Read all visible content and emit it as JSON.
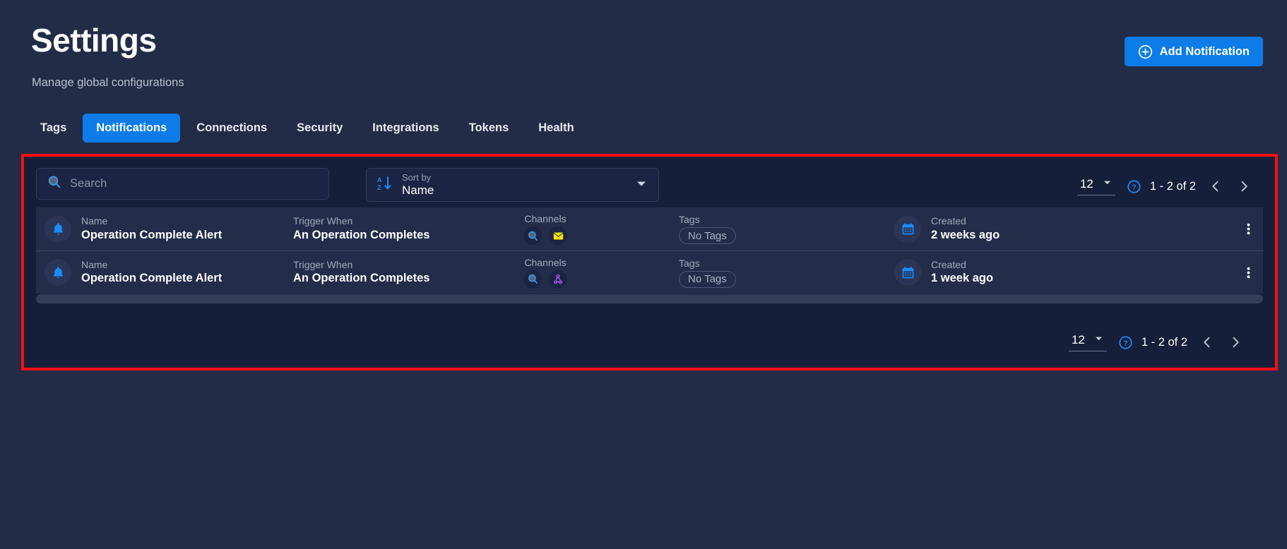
{
  "header": {
    "title": "Settings",
    "subtitle": "Manage global configurations",
    "add_button": {
      "label": "Add Notification",
      "icon": "plus-circle-icon"
    }
  },
  "tabs": [
    {
      "label": "Tags",
      "active": false
    },
    {
      "label": "Notifications",
      "active": true
    },
    {
      "label": "Connections",
      "active": false
    },
    {
      "label": "Security",
      "active": false
    },
    {
      "label": "Integrations",
      "active": false
    },
    {
      "label": "Tokens",
      "active": false
    },
    {
      "label": "Health",
      "active": false
    }
  ],
  "toolbar": {
    "search": {
      "value": "",
      "placeholder": "Search",
      "icon": "search-icon"
    },
    "sort": {
      "label": "Sort by",
      "value": "Name",
      "icon": "sort-alpha-down-icon",
      "caret": "chevron-down-icon"
    }
  },
  "pagination": {
    "page_size": "12",
    "range": "1 - 2 of 2",
    "help_icon": "question-circle-icon",
    "prev_icon": "chevron-left-icon",
    "next_icon": "chevron-right-icon",
    "caret_icon": "caret-down-icon"
  },
  "columns": {
    "name": "Name",
    "trigger": "Trigger When",
    "channels": "Channels",
    "tags": "Tags",
    "created": "Created"
  },
  "rows": [
    {
      "icon": "bell-icon",
      "name": "Operation Complete Alert",
      "trigger": "An Operation Completes",
      "channels": [
        "search-icon",
        "email-icon"
      ],
      "tags": "No Tags",
      "created": "2 weeks ago",
      "menu_icon": "kebab-menu-icon"
    },
    {
      "icon": "bell-icon",
      "name": "Operation Complete Alert",
      "trigger": "An Operation Completes",
      "channels": [
        "search-icon",
        "webhook-icon"
      ],
      "tags": "No Tags",
      "created": "1 week ago",
      "menu_icon": "kebab-menu-icon"
    }
  ],
  "colors": {
    "page_bg": "#222c47",
    "panel_bg": "#161f3a",
    "row_bg": "#232d4a",
    "accent": "#0d7ce8",
    "highlight_border": "#fb0f0f",
    "email_icon": "#f5e30f",
    "webhook_icon": "#a44ef0"
  }
}
